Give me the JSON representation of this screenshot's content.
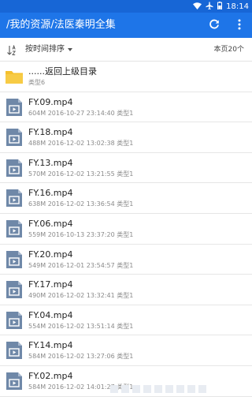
{
  "status_bar": {
    "time": "18:14"
  },
  "app_bar": {
    "title": "/我的资源/法医秦明全集"
  },
  "sort_bar": {
    "sort_label": "按时间排序",
    "page_count": "本页20个"
  },
  "parent_item": {
    "title": "......返回上级目录",
    "meta": "类型6"
  },
  "files": [
    {
      "name": "FY.09.mp4",
      "size": "604M",
      "date": "2016-10-27 23:14:40",
      "type": "类型1"
    },
    {
      "name": "FY.18.mp4",
      "size": "488M",
      "date": "2016-12-02 13:02:38",
      "type": "类型1"
    },
    {
      "name": "FY.13.mp4",
      "size": "570M",
      "date": "2016-12-02 13:21:55",
      "type": "类型1"
    },
    {
      "name": "FY.16.mp4",
      "size": "638M",
      "date": "2016-12-02 13:36:54",
      "type": "类型1"
    },
    {
      "name": "FY.06.mp4",
      "size": "559M",
      "date": "2016-10-13 23:37:20",
      "type": "类型1"
    },
    {
      "name": "FY.20.mp4",
      "size": "549M",
      "date": "2016-12-01 23:54:57",
      "type": "类型1"
    },
    {
      "name": "FY.17.mp4",
      "size": "490M",
      "date": "2016-12-02 13:32:41",
      "type": "类型1"
    },
    {
      "name": "FY.04.mp4",
      "size": "554M",
      "date": "2016-12-02 13:51:14",
      "type": "类型1"
    },
    {
      "name": "FY.14.mp4",
      "size": "584M",
      "date": "2016-12-02 13:27:06",
      "type": "类型1"
    },
    {
      "name": "FY.02.mp4",
      "size": "584M",
      "date": "2016-12-02 14:01:27",
      "type": "类型1"
    }
  ],
  "icons": {
    "wifi": "wifi-icon",
    "airplane": "airplane-icon",
    "battery": "battery-icon",
    "refresh": "refresh-icon",
    "more": "more-vert-icon",
    "sort": "sort-icon",
    "folder": "folder-icon",
    "video": "video-file-icon"
  },
  "colors": {
    "status_bar": "#1766d6",
    "app_bar": "#1e75e8",
    "folder": "#f5c02e",
    "video_icon": "#6f88a8"
  }
}
